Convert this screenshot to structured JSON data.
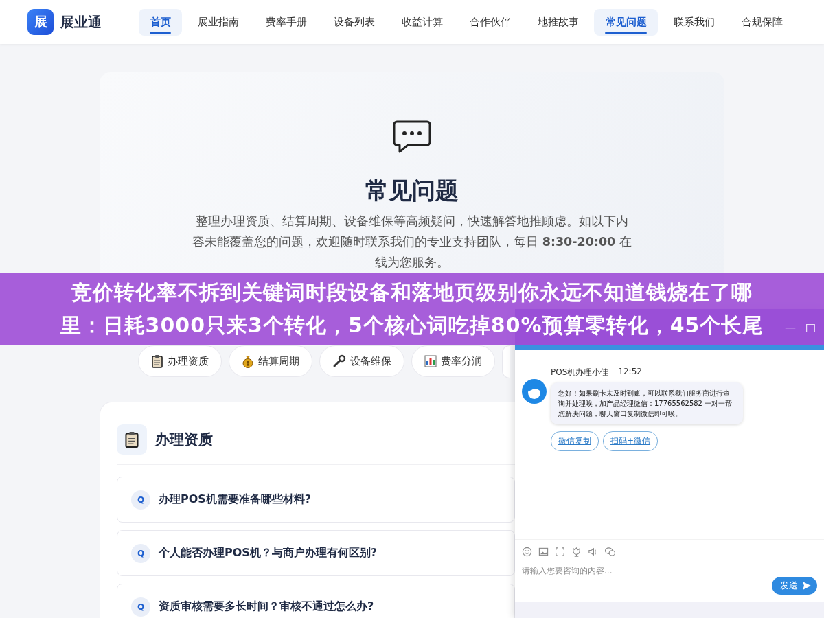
{
  "header": {
    "logo_mark": "展",
    "brand": "展业通",
    "nav": [
      {
        "label": "首页",
        "selected": true
      },
      {
        "label": "展业指南",
        "selected": false
      },
      {
        "label": "费率手册",
        "selected": false
      },
      {
        "label": "设备列表",
        "selected": false
      },
      {
        "label": "收益计算",
        "selected": false
      },
      {
        "label": "合作伙伴",
        "selected": false
      },
      {
        "label": "地推故事",
        "selected": false
      },
      {
        "label": "常见问题",
        "selected": true
      },
      {
        "label": "联系我们",
        "selected": false
      },
      {
        "label": "合规保障",
        "selected": false
      }
    ]
  },
  "hero": {
    "title": "常见问题",
    "description": "整理办理资质、结算周期、设备维保等高频疑问，快速解答地推顾虑。如以下内容未能覆盖您的问题，欢迎随时联系我们的专业支持团队，每日 **8:30-20:00** 在线为您服务。"
  },
  "categories": [
    {
      "kind": "clipboard",
      "label": "办理资质"
    },
    {
      "kind": "moneybag",
      "label": "结算周期"
    },
    {
      "kind": "wrench",
      "label": "设备维保"
    },
    {
      "kind": "chart",
      "label": "费率分润"
    }
  ],
  "faq_section": {
    "title": "办理资质",
    "questions": [
      {
        "badge": "Q",
        "text": "办理POS机需要准备哪些材料?"
      },
      {
        "badge": "Q",
        "text": "个人能否办理POS机？与商户办理有何区别?"
      },
      {
        "badge": "Q",
        "text": "资质审核需要多长时间？审核不通过怎么办?"
      }
    ]
  },
  "banner": {
    "lines": [
      "竞价转化率不拆到关键词时段设备和落地页级别你永远不知道钱烧在了哪",
      "里：日耗3000只来3个转化，5个核心词吃掉80%预算零转化，45个长尾"
    ]
  },
  "chat": {
    "minimize": "—",
    "maximize": "□",
    "message": {
      "sender": "POS机办理小佳",
      "time": "12:52",
      "text": "您好！如果刷卡未及时到账，可以联系我们服务商进行查询并处理唉，加产品经理微信：17765562582 一对一帮您解决问题，聊天窗口复制微信即可唉。"
    },
    "actions": [
      "微信复制",
      "扫码+微信"
    ],
    "input": {
      "placeholder": "请输入您要咨询的内容..."
    },
    "send": "发送"
  }
}
